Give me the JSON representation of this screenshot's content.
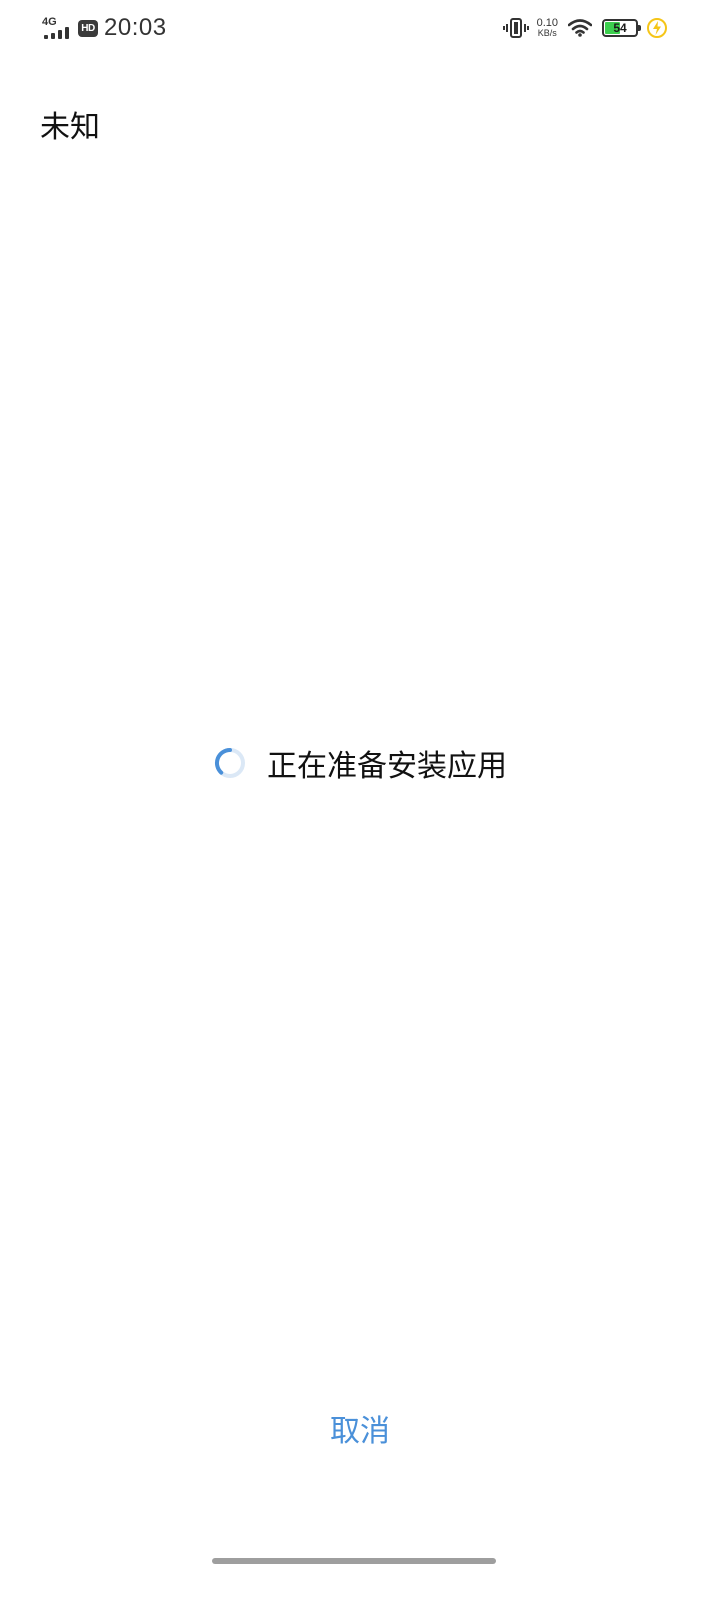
{
  "status_bar": {
    "network_type": "4G",
    "hd_badge": "HD",
    "time": "20:03",
    "net_speed_value": "0.10",
    "net_speed_unit": "KB/s",
    "battery_level": "54",
    "battery_fraction": 0.54,
    "icons": [
      "signal-icon",
      "vibrate-icon",
      "wifi-icon",
      "battery-icon",
      "charging-icon"
    ]
  },
  "app": {
    "name": "未知"
  },
  "progress": {
    "message": "正在准备安装应用"
  },
  "actions": {
    "cancel_label": "取消"
  },
  "colors": {
    "accent": "#4a90d9",
    "battery_fill": "#3ccf4e",
    "charging": "#f5c518"
  }
}
